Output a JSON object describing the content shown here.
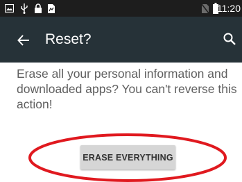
{
  "status_bar": {
    "time": "11:20",
    "icons": [
      "image-icon",
      "usb-icon",
      "lock-icon",
      "notification-icon",
      "no-sim-icon",
      "battery-icon"
    ]
  },
  "app_bar": {
    "title": "Reset?",
    "back_icon": "arrow-back-icon",
    "search_icon": "search-icon",
    "background": "#263238"
  },
  "content": {
    "message": "Erase all your personal information and downloaded apps? You can't reverse this action!",
    "button_label": "ERASE EVERYTHING"
  },
  "annotation": {
    "color": "#e0191f",
    "shape": "ellipse"
  }
}
